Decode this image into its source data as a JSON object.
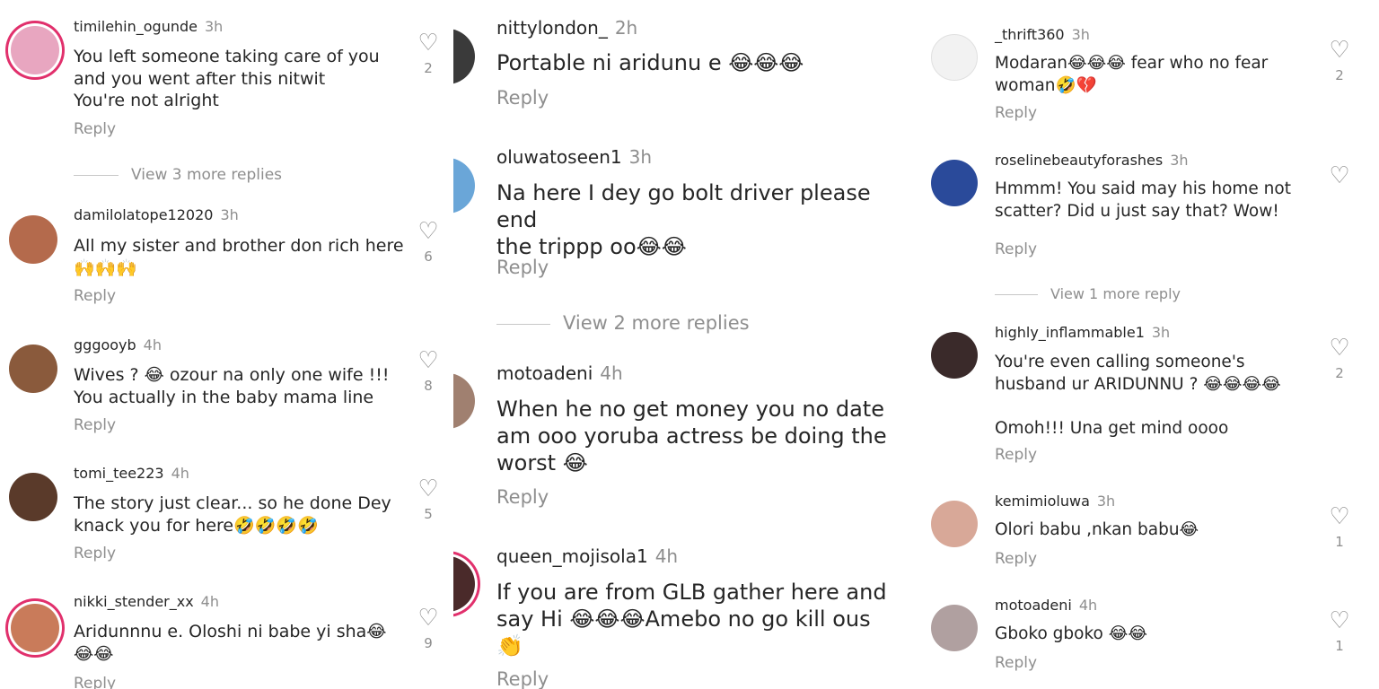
{
  "panels": [
    {
      "comments": [
        {
          "username": "timilehin_ogunde",
          "time": "3h",
          "text": "You left someone taking care of you\nand you went after this nitwit\nYou're not alright",
          "reply": "Reply",
          "likes": "2",
          "avatar_color": "#e8a6c0"
        },
        {
          "username": "damilolatope12020",
          "time": "3h",
          "text": "All my sister and brother don rich here\n🙌🙌🙌",
          "reply": "Reply",
          "likes": "6",
          "avatar_color": "#b46a4c"
        },
        {
          "username": "gggooyb",
          "time": "4h",
          "text": "Wives ? 😂 ozour na only one wife !!!\nYou actually in the baby mama line",
          "reply": "Reply",
          "likes": "8",
          "avatar_color": "#8a5a3c"
        },
        {
          "username": "tomi_tee223",
          "time": "4h",
          "text": "The story just clear... so he done Dey\nknack you for here🤣🤣🤣🤣",
          "reply": "Reply",
          "likes": "5",
          "avatar_color": "#5a3a2a"
        },
        {
          "username": "nikki_stender_xx",
          "time": "4h",
          "text": "Aridunnnu e. Oloshi ni babe yi sha😂\n😂😂",
          "reply": "Reply",
          "likes": "9",
          "avatar_color": "#c97b5a"
        }
      ],
      "view_more": "View 3 more replies"
    },
    {
      "comments": [
        {
          "username": "nittylondon_",
          "time": "2h",
          "text": "Portable ni aridunu e 😂😂😂",
          "reply": "Reply",
          "avatar_color": "#3a3a3a"
        },
        {
          "username": "oluwatoseen1",
          "time": "3h",
          "text": "Na here I dey go bolt driver please end\nthe trippp oo😂😂",
          "reply": "Reply",
          "avatar_color": "#6aa6d8"
        },
        {
          "username": "motoadeni",
          "time": "4h",
          "text": "When he no get money you no date\nam ooo yoruba actress be doing the\nworst 😂",
          "reply": "Reply",
          "avatar_color": "#a08070"
        },
        {
          "username": "queen_mojisola1",
          "time": "4h",
          "text": "If you are from GLB gather here and\nsay Hi 😂😂😂Amebo no go kill ous\n👏",
          "reply": "Reply",
          "avatar_color": "#4a2a2a"
        }
      ],
      "view_more": "View 2 more replies"
    },
    {
      "comments": [
        {
          "username": "_thrift360",
          "time": "3h",
          "text": "Modaran😂😂😂 fear who no fear\nwoman🤣💔",
          "reply": "Reply",
          "likes": "2",
          "avatar_color": "#f2f2f2"
        },
        {
          "username": "roselinebeautyforashes",
          "time": "3h",
          "text": "Hmmm! You said may his home not\nscatter? Did u just say that? Wow!",
          "reply": "Reply",
          "likes": "",
          "avatar_color": "#2a4a9a"
        },
        {
          "username": "highly_inflammable1",
          "time": "3h",
          "text": "You're even calling someone's\nhusband ur ARIDUNNU ? 😂😂😂😂\n\nOmoh!!! Una get mind oooo",
          "reply": "Reply",
          "likes": "2",
          "avatar_color": "#3a2a2a"
        },
        {
          "username": "kemimioluwa",
          "time": "3h",
          "text": "Olori babu ,nkan babu😂",
          "reply": "Reply",
          "likes": "1",
          "avatar_color": "#d8a898"
        },
        {
          "username": "motoadeni",
          "time": "4h",
          "text": "Gboko gboko 😂😂",
          "reply": "Reply",
          "likes": "1",
          "avatar_color": "#b0a0a0"
        }
      ],
      "view_more": "View 1 more reply"
    }
  ],
  "icons": {
    "heart": "heart-outline-icon",
    "heart_glyph": "♡"
  }
}
